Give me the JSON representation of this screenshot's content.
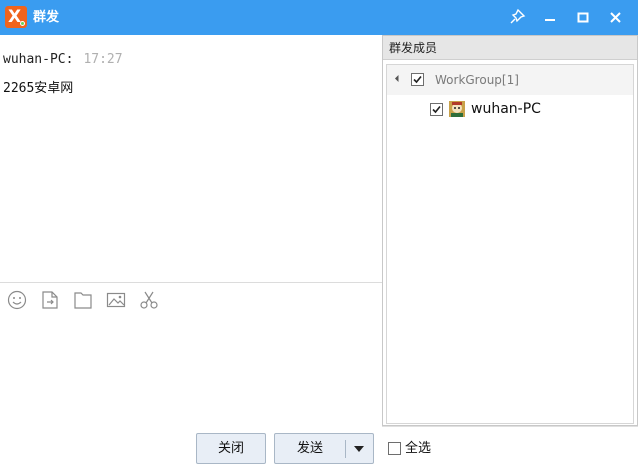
{
  "window": {
    "title": "群发",
    "controls": [
      "pin-icon",
      "minimize-icon",
      "maximize-icon",
      "close-icon"
    ]
  },
  "chat": {
    "messages": [
      {
        "sender": "wuhan-PC:",
        "time": "17:27",
        "text": "2265安卓网"
      }
    ]
  },
  "toolbar": {
    "icons": [
      "emoji-icon",
      "file-transfer-icon",
      "folder-icon",
      "image-icon",
      "scissors-icon"
    ]
  },
  "buttons": {
    "close_label": "关闭",
    "send_label": "发送"
  },
  "members": {
    "title": "群发成员",
    "groups": [
      {
        "label": "WorkGroup[1]",
        "checked": true,
        "expanded": true,
        "members": [
          {
            "label": "wuhan-PC",
            "checked": true
          }
        ]
      }
    ],
    "select_all_label": "全选",
    "select_all_checked": false
  },
  "colors": {
    "titlebar": "#3a9cf0",
    "logo": "#f0641e",
    "time_text": "#b0b0b0"
  }
}
